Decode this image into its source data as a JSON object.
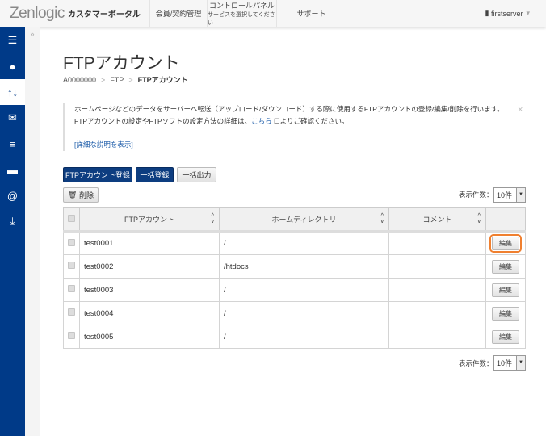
{
  "header": {
    "logo": "Zenlogic",
    "portal": "カスタマーポータル",
    "nav": [
      {
        "label": "会員/契約管理"
      },
      {
        "label": "コントロールパネル",
        "sub": "サービスを選択してください"
      },
      {
        "label": "サポート"
      }
    ],
    "user": "firstserver"
  },
  "sidebar": {
    "items": [
      {
        "icon": "server-icon"
      },
      {
        "icon": "globe-icon"
      },
      {
        "icon": "transfer-arrows-icon",
        "active": true
      },
      {
        "icon": "mail-icon"
      },
      {
        "icon": "database-icon"
      },
      {
        "icon": "folder-icon"
      },
      {
        "icon": "at-sign-icon"
      },
      {
        "icon": "download-icon"
      }
    ],
    "expand": "»"
  },
  "page": {
    "title": "FTPアカウント",
    "breadcrumb": [
      "A0000000",
      "FTP",
      "FTPアカウント"
    ]
  },
  "info": {
    "line1": "ホームページなどのデータをサーバーへ転送（アップロード/ダウンロード）する際に使用するFTPアカウントの登録/編集/削除を行います。",
    "line2a": "FTPアカウントの設定やFTPソフトの設定方法の詳細は、",
    "link": "こちら",
    "line2b": " ☐よりご確認ください。",
    "detail": "[詳細な説明を表示]",
    "close": "×"
  },
  "toolbar": {
    "register": "FTPアカウント登録",
    "bulk_register": "一括登録",
    "bulk_export": "一括出力",
    "delete": "削除",
    "per_page_label": "表示件数：",
    "per_page": "10件"
  },
  "table": {
    "headers": [
      "FTPアカウント",
      "ホームディレクトリ",
      "コメント"
    ],
    "edit_label": "編集",
    "rows": [
      {
        "account": "test0001",
        "home": "/",
        "comment": ""
      },
      {
        "account": "test0002",
        "home": "/htdocs",
        "comment": ""
      },
      {
        "account": "test0003",
        "home": "/",
        "comment": ""
      },
      {
        "account": "test0004",
        "home": "/",
        "comment": ""
      },
      {
        "account": "test0005",
        "home": "/",
        "comment": ""
      }
    ]
  },
  "colors": {
    "brand": "#003a88",
    "highlight": "#f08030"
  }
}
